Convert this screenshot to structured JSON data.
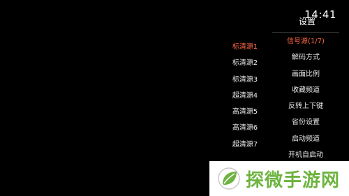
{
  "status_bar": {
    "time": "14:41"
  },
  "settings_panel": {
    "title": "设置",
    "menu": [
      {
        "label": "信号源(1/7)",
        "active": true
      },
      {
        "label": "解码方式"
      },
      {
        "label": "画面比例"
      },
      {
        "label": "收藏频道"
      },
      {
        "label": "反转上下键"
      },
      {
        "label": "省份设置"
      },
      {
        "label": "启动频道"
      },
      {
        "label": "开机自启动"
      }
    ],
    "sources": [
      {
        "label": "标清源1",
        "active": true
      },
      {
        "label": "标清源2"
      },
      {
        "label": "标清源3"
      },
      {
        "label": "超清源4"
      },
      {
        "label": "高清源5"
      },
      {
        "label": "高清源6"
      },
      {
        "label": "超清源7"
      }
    ]
  },
  "watermark": {
    "text": "探微手游网",
    "logo_icon": "leaf-logo-icon",
    "color": "#6db33f"
  },
  "colors": {
    "background": "#000000",
    "text": "#e8e8e8",
    "accent": "#ff6a43"
  }
}
